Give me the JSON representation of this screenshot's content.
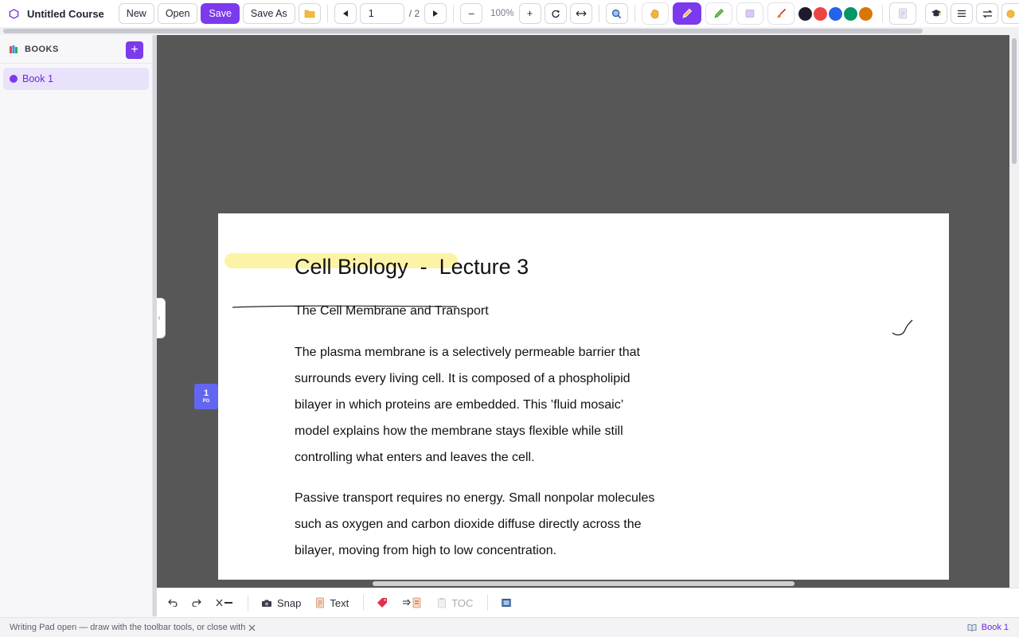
{
  "app": {
    "title": "Untitled Course"
  },
  "toolbar": {
    "new_label": "New",
    "open_label": "Open",
    "save_label": "Save",
    "save_as_label": "Save As",
    "page_value": "1",
    "page_total": "/ 2",
    "zoom_out_label": "–",
    "zoom_level": "100%",
    "zoom_in_label": "+",
    "pen_colors": [
      "#1e1b2e",
      "#ef4444",
      "#2563eb",
      "#059669",
      "#d97706"
    ],
    "accent_color": "#7c3aed"
  },
  "sidebar": {
    "header": "BOOKS",
    "add_label": "+",
    "items": [
      {
        "label": "Book 1"
      }
    ]
  },
  "document": {
    "title": "Cell Biology  -  Lecture 3",
    "subtitle": "The Cell Membrane and Transport",
    "paragraph1_lines": [
      "The plasma membrane is a selectively permeable barrier that",
      "surrounds every living cell. It is composed of a phospholipid",
      "bilayer in which proteins are embedded. This ’fluid mosaic’",
      "model explains how the membrane stays flexible while still",
      "controlling what enters and leaves the cell."
    ],
    "paragraph2_lines": [
      "Passive transport requires no energy. Small nonpolar molecules",
      "such as oxygen and carbon dioxide diffuse directly across the",
      "bilayer, moving from high to low concentration."
    ],
    "page_badge_number": "1",
    "page_badge_suffix": "PG"
  },
  "bottom_toolbar": {
    "snap_label": "Snap",
    "text_label": "Text",
    "toc_label": "TOC"
  },
  "status": {
    "message": "Writing Pad open — draw with the toolbar tools, or close with",
    "book_label": "Book 1"
  }
}
